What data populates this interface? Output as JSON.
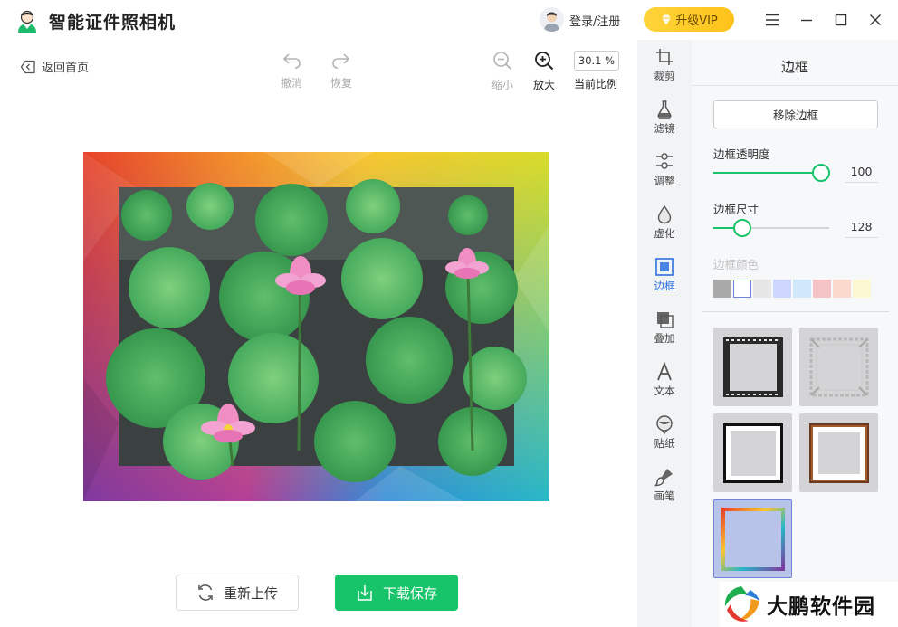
{
  "app": {
    "title": "智能证件照相机"
  },
  "header": {
    "login_label": "登录/注册",
    "vip_label": "升级VIP"
  },
  "toolbar": {
    "back_label": "返回首页",
    "undo_label": "撤消",
    "redo_label": "恢复",
    "zoom_out_label": "缩小",
    "zoom_in_label": "放大",
    "zoom_value": "30.1 %",
    "zoom_ratio_label": "当前比例"
  },
  "actions": {
    "reupload_label": "重新上传",
    "save_label": "下载保存"
  },
  "sidebar": {
    "items": [
      {
        "label": "裁剪",
        "icon": "crop-icon"
      },
      {
        "label": "滤镜",
        "icon": "flask-icon"
      },
      {
        "label": "调整",
        "icon": "sliders-icon"
      },
      {
        "label": "虚化",
        "icon": "droplet-icon"
      },
      {
        "label": "边框",
        "icon": "frame-icon"
      },
      {
        "label": "叠加",
        "icon": "overlay-icon"
      },
      {
        "label": "文本",
        "icon": "text-icon"
      },
      {
        "label": "贴纸",
        "icon": "sticker-icon"
      },
      {
        "label": "画笔",
        "icon": "brush-icon"
      }
    ],
    "active_index": 4
  },
  "panel": {
    "title": "边框",
    "remove_label": "移除边框",
    "opacity_label": "边框透明度",
    "opacity_value": "100",
    "opacity_fraction": 0.93,
    "size_label": "边框尺寸",
    "size_value": "128",
    "size_fraction": 0.25,
    "color_label": "边框颜色",
    "swatches": [
      "#a9a9a9",
      "#ffffff",
      "#e6e6e6",
      "#ccd6ff",
      "#cfe9fb",
      "#f4c4c6",
      "#fbd9cc",
      "#fbf8d2"
    ],
    "frames": [
      "film-frame",
      "ornate-frame",
      "black-frame",
      "wood-frame",
      "rainbow-frame"
    ],
    "selected_frame": 4
  },
  "watermark": {
    "text": "大鹏软件园"
  },
  "colors": {
    "accent_green": "#18c46a",
    "active_blue": "#2e6fe0",
    "vip_yellow": "#ffcc2a"
  }
}
